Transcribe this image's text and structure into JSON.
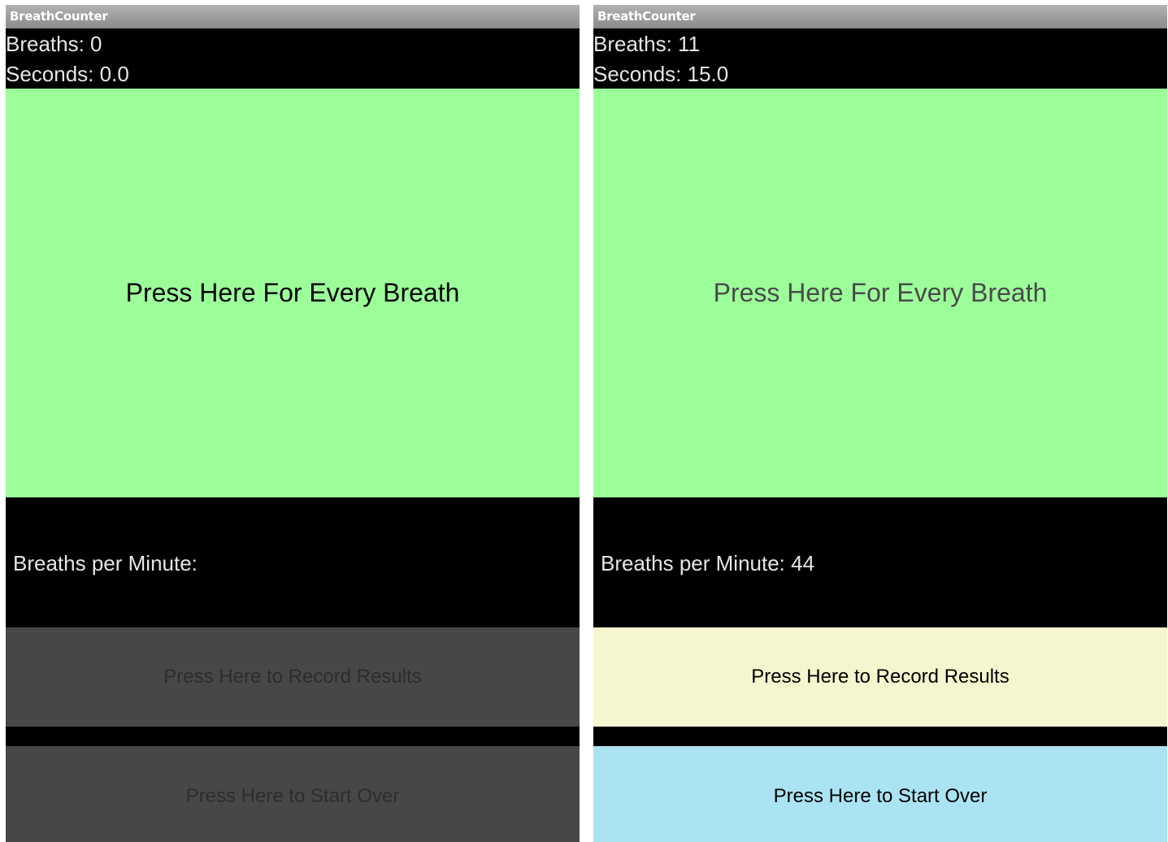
{
  "screens": [
    {
      "title": "BreathCounter",
      "breaths_label": "Breaths: 0",
      "seconds_label": "Seconds: 0.0",
      "breath_button": "Press Here For Every Breath",
      "bpm_label": "Breaths per Minute:",
      "record_button": "Press Here to Record Results",
      "restart_button": "Press Here to Start Over",
      "colors": {
        "breath_button_bg": "#9cff9a",
        "breath_button_text": "#000000",
        "record_button_bg": "#474747",
        "record_button_text": "#2d2d2d",
        "restart_button_bg": "#474747",
        "restart_button_text": "#2d2d2d"
      }
    },
    {
      "title": "BreathCounter",
      "breaths_label": "Breaths: 11",
      "seconds_label": "Seconds: 15.0",
      "breath_button": "Press Here For Every Breath",
      "bpm_label": "Breaths per Minute: 44",
      "record_button": "Press Here to Record Results",
      "restart_button": "Press Here to Start Over",
      "colors": {
        "breath_button_bg": "#9cff9a",
        "breath_button_text": "#4a4a4a",
        "record_button_bg": "#f5f6cf",
        "record_button_text": "#000000",
        "restart_button_bg": "#aae3f3",
        "restart_button_text": "#000000"
      }
    }
  ]
}
